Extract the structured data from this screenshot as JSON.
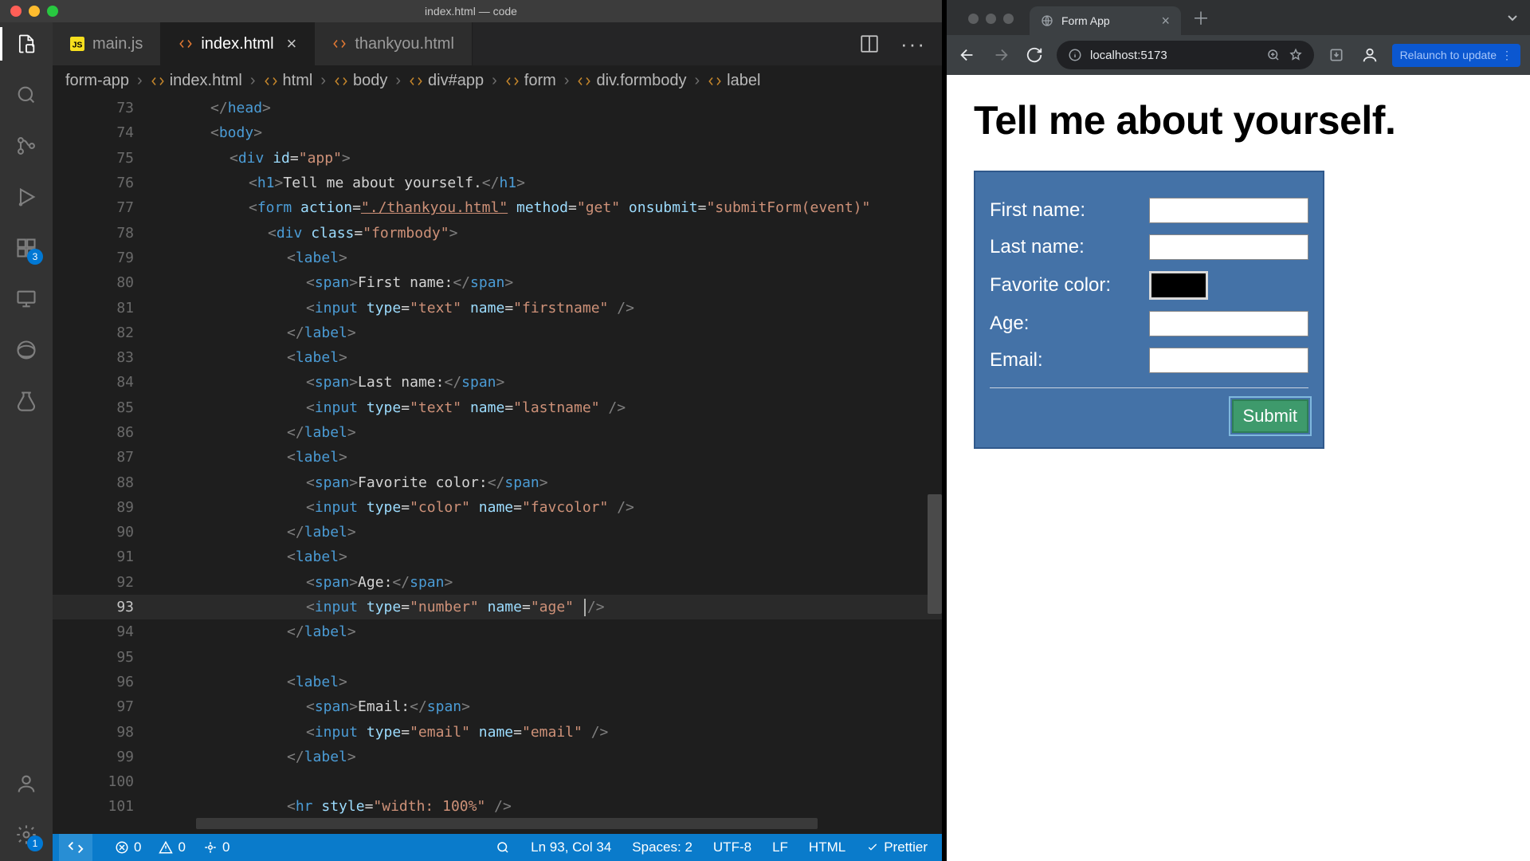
{
  "vscode": {
    "window_title": "index.html — code",
    "tabs": [
      {
        "label": "main.js"
      },
      {
        "label": "index.html",
        "active": true
      },
      {
        "label": "thankyou.html"
      }
    ],
    "breadcrumbs": [
      "form-app",
      "index.html",
      "html",
      "body",
      "div#app",
      "form",
      "div.formbody",
      "label"
    ],
    "activity_badges": {
      "extensions": "3",
      "settings": "1"
    },
    "line_start": 73,
    "code": [
      "    </head>",
      "    <body>",
      "      <div id=\"app\">",
      "        <h1>Tell me about yourself.</h1>",
      "        <form action=\"./thankyou.html\" method=\"get\" onsubmit=\"submitForm(event)\"",
      "          <div class=\"formbody\">",
      "            <label>",
      "              <span>First name:</span>",
      "              <input type=\"text\" name=\"firstname\" />",
      "            </label>",
      "            <label>",
      "              <span>Last name:</span>",
      "              <input type=\"text\" name=\"lastname\" />",
      "            </label>",
      "            <label>",
      "              <span>Favorite color:</span>",
      "              <input type=\"color\" name=\"favcolor\" />",
      "            </label>",
      "            <label>",
      "              <span>Age:</span>",
      "              <input type=\"number\" name=\"age\" />",
      "            </label>",
      "",
      "            <label>",
      "              <span>Email:</span>",
      "              <input type=\"email\" name=\"email\" />",
      "            </label>",
      "",
      "            <hr style=\"width: 100%\" />"
    ],
    "cursor_line": 93,
    "statusbar": {
      "errors": "0",
      "warnings": "0",
      "ports": "0",
      "cursor": "Ln 93, Col 34",
      "spaces": "Spaces: 2",
      "encoding": "UTF-8",
      "eol": "LF",
      "lang": "HTML",
      "formatter": "Prettier"
    }
  },
  "browser": {
    "tab_title": "Form App",
    "url": "localhost:5173",
    "relaunch": "Relaunch to update",
    "page": {
      "heading": "Tell me about yourself.",
      "labels": {
        "first": "First name:",
        "last": "Last name:",
        "color": "Favorite color:",
        "age": "Age:",
        "email": "Email:"
      },
      "submit": "Submit"
    }
  }
}
